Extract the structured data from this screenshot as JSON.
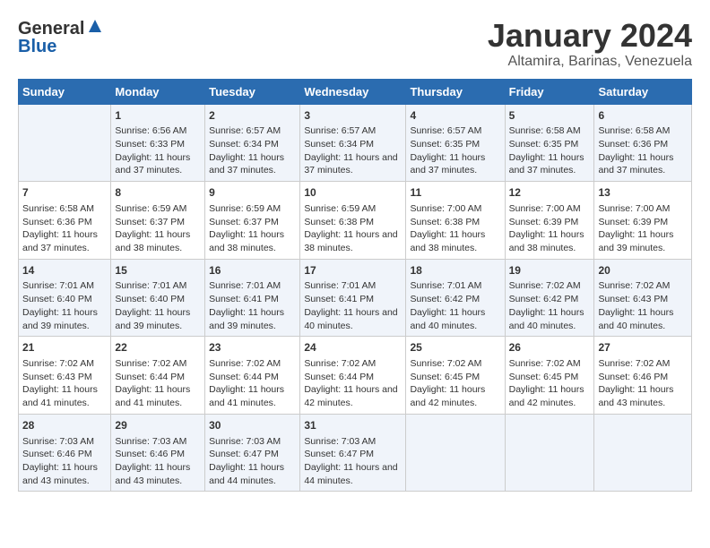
{
  "logo": {
    "general": "General",
    "blue": "Blue"
  },
  "title": "January 2024",
  "subtitle": "Altamira, Barinas, Venezuela",
  "days_of_week": [
    "Sunday",
    "Monday",
    "Tuesday",
    "Wednesday",
    "Thursday",
    "Friday",
    "Saturday"
  ],
  "weeks": [
    [
      {
        "day": "",
        "sunrise": "",
        "sunset": "",
        "daylight": ""
      },
      {
        "day": "1",
        "sunrise": "6:56 AM",
        "sunset": "6:33 PM",
        "daylight": "11 hours and 37 minutes."
      },
      {
        "day": "2",
        "sunrise": "6:57 AM",
        "sunset": "6:34 PM",
        "daylight": "11 hours and 37 minutes."
      },
      {
        "day": "3",
        "sunrise": "6:57 AM",
        "sunset": "6:34 PM",
        "daylight": "11 hours and 37 minutes."
      },
      {
        "day": "4",
        "sunrise": "6:57 AM",
        "sunset": "6:35 PM",
        "daylight": "11 hours and 37 minutes."
      },
      {
        "day": "5",
        "sunrise": "6:58 AM",
        "sunset": "6:35 PM",
        "daylight": "11 hours and 37 minutes."
      },
      {
        "day": "6",
        "sunrise": "6:58 AM",
        "sunset": "6:36 PM",
        "daylight": "11 hours and 37 minutes."
      }
    ],
    [
      {
        "day": "7",
        "sunrise": "6:58 AM",
        "sunset": "6:36 PM",
        "daylight": "11 hours and 37 minutes."
      },
      {
        "day": "8",
        "sunrise": "6:59 AM",
        "sunset": "6:37 PM",
        "daylight": "11 hours and 38 minutes."
      },
      {
        "day": "9",
        "sunrise": "6:59 AM",
        "sunset": "6:37 PM",
        "daylight": "11 hours and 38 minutes."
      },
      {
        "day": "10",
        "sunrise": "6:59 AM",
        "sunset": "6:38 PM",
        "daylight": "11 hours and 38 minutes."
      },
      {
        "day": "11",
        "sunrise": "7:00 AM",
        "sunset": "6:38 PM",
        "daylight": "11 hours and 38 minutes."
      },
      {
        "day": "12",
        "sunrise": "7:00 AM",
        "sunset": "6:39 PM",
        "daylight": "11 hours and 38 minutes."
      },
      {
        "day": "13",
        "sunrise": "7:00 AM",
        "sunset": "6:39 PM",
        "daylight": "11 hours and 39 minutes."
      }
    ],
    [
      {
        "day": "14",
        "sunrise": "7:01 AM",
        "sunset": "6:40 PM",
        "daylight": "11 hours and 39 minutes."
      },
      {
        "day": "15",
        "sunrise": "7:01 AM",
        "sunset": "6:40 PM",
        "daylight": "11 hours and 39 minutes."
      },
      {
        "day": "16",
        "sunrise": "7:01 AM",
        "sunset": "6:41 PM",
        "daylight": "11 hours and 39 minutes."
      },
      {
        "day": "17",
        "sunrise": "7:01 AM",
        "sunset": "6:41 PM",
        "daylight": "11 hours and 40 minutes."
      },
      {
        "day": "18",
        "sunrise": "7:01 AM",
        "sunset": "6:42 PM",
        "daylight": "11 hours and 40 minutes."
      },
      {
        "day": "19",
        "sunrise": "7:02 AM",
        "sunset": "6:42 PM",
        "daylight": "11 hours and 40 minutes."
      },
      {
        "day": "20",
        "sunrise": "7:02 AM",
        "sunset": "6:43 PM",
        "daylight": "11 hours and 40 minutes."
      }
    ],
    [
      {
        "day": "21",
        "sunrise": "7:02 AM",
        "sunset": "6:43 PM",
        "daylight": "11 hours and 41 minutes."
      },
      {
        "day": "22",
        "sunrise": "7:02 AM",
        "sunset": "6:44 PM",
        "daylight": "11 hours and 41 minutes."
      },
      {
        "day": "23",
        "sunrise": "7:02 AM",
        "sunset": "6:44 PM",
        "daylight": "11 hours and 41 minutes."
      },
      {
        "day": "24",
        "sunrise": "7:02 AM",
        "sunset": "6:44 PM",
        "daylight": "11 hours and 42 minutes."
      },
      {
        "day": "25",
        "sunrise": "7:02 AM",
        "sunset": "6:45 PM",
        "daylight": "11 hours and 42 minutes."
      },
      {
        "day": "26",
        "sunrise": "7:02 AM",
        "sunset": "6:45 PM",
        "daylight": "11 hours and 42 minutes."
      },
      {
        "day": "27",
        "sunrise": "7:02 AM",
        "sunset": "6:46 PM",
        "daylight": "11 hours and 43 minutes."
      }
    ],
    [
      {
        "day": "28",
        "sunrise": "7:03 AM",
        "sunset": "6:46 PM",
        "daylight": "11 hours and 43 minutes."
      },
      {
        "day": "29",
        "sunrise": "7:03 AM",
        "sunset": "6:46 PM",
        "daylight": "11 hours and 43 minutes."
      },
      {
        "day": "30",
        "sunrise": "7:03 AM",
        "sunset": "6:47 PM",
        "daylight": "11 hours and 44 minutes."
      },
      {
        "day": "31",
        "sunrise": "7:03 AM",
        "sunset": "6:47 PM",
        "daylight": "11 hours and 44 minutes."
      },
      {
        "day": "",
        "sunrise": "",
        "sunset": "",
        "daylight": ""
      },
      {
        "day": "",
        "sunrise": "",
        "sunset": "",
        "daylight": ""
      },
      {
        "day": "",
        "sunrise": "",
        "sunset": "",
        "daylight": ""
      }
    ]
  ]
}
